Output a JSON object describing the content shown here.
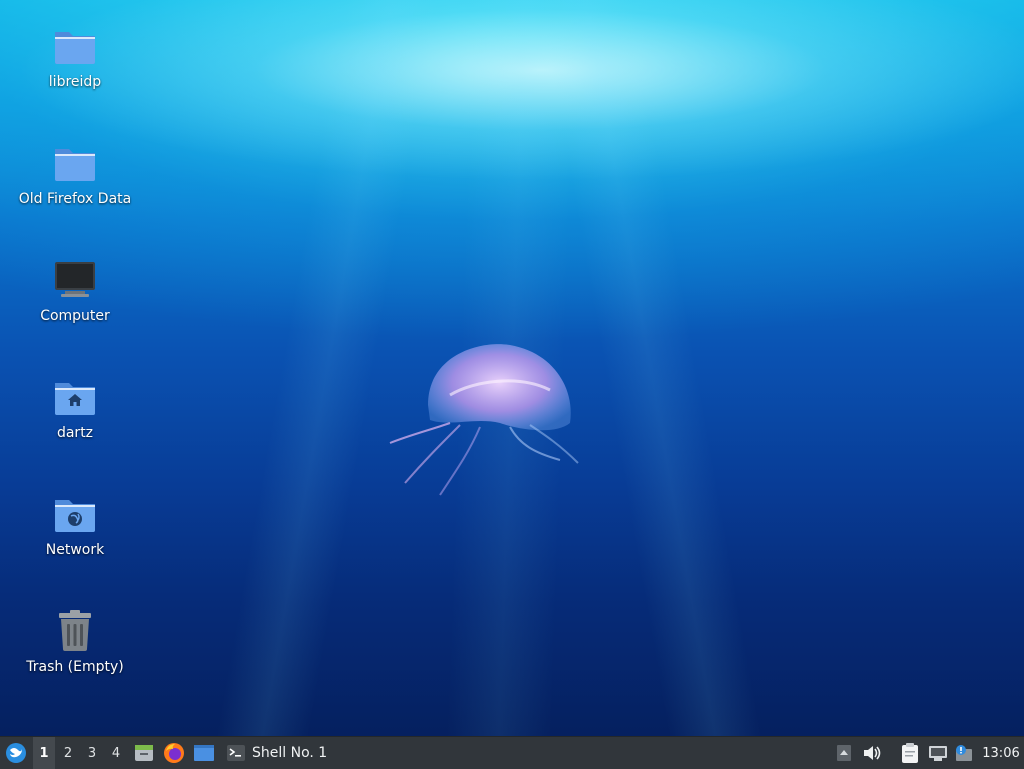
{
  "desktop": {
    "icons": [
      {
        "label": "libreidp",
        "icon": "folder-icon"
      },
      {
        "label": "Old Firefox Data",
        "icon": "folder-icon"
      },
      {
        "label": "Computer",
        "icon": "computer-icon"
      },
      {
        "label": "dartz",
        "icon": "home-folder-icon"
      },
      {
        "label": "Network",
        "icon": "network-folder-icon"
      },
      {
        "label": "Trash (Empty)",
        "icon": "trash-icon"
      }
    ]
  },
  "taskbar": {
    "start_icon": "start-menu-icon",
    "workspaces": [
      "1",
      "2",
      "3",
      "4"
    ],
    "active_workspace": "1",
    "launchers": [
      {
        "name": "file-manager-icon"
      },
      {
        "name": "firefox-icon"
      },
      {
        "name": "show-desktop-icon"
      }
    ],
    "tasks": [
      {
        "label": "Shell No. 1",
        "icon": "terminal-icon"
      }
    ],
    "tray": [
      "tray-expand-icon",
      "volume-icon",
      "clipboard-icon",
      "network-wired-icon",
      "update-notifier-icon"
    ],
    "clock": "13:06"
  },
  "colors": {
    "taskbar_bg": "#31363b",
    "folder_blue": "#5b9ae6",
    "desktop_deep": "#05205f",
    "desktop_surface": "#19c6ec"
  }
}
